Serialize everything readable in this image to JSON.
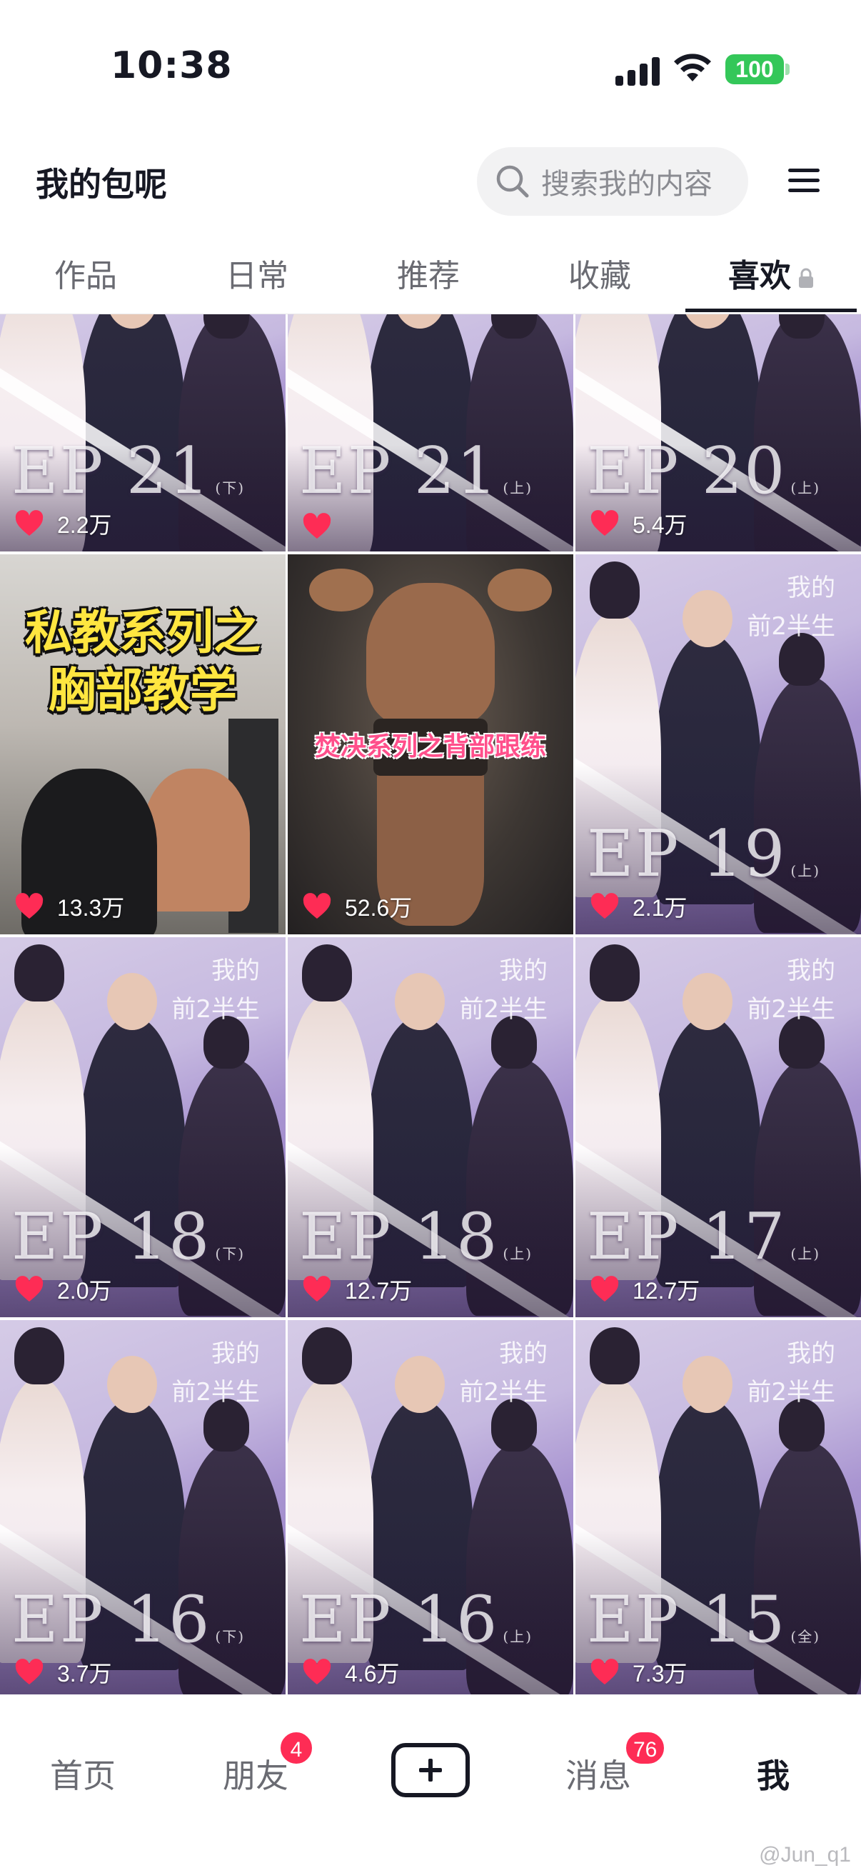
{
  "status_bar": {
    "time": "10:38",
    "battery": "100"
  },
  "header": {
    "profile_name": "我的包呢",
    "search_placeholder": "搜索我的内容"
  },
  "tabs": [
    {
      "label": "作品"
    },
    {
      "label": "日常"
    },
    {
      "label": "推荐"
    },
    {
      "label": "收藏"
    },
    {
      "label": "喜欢"
    }
  ],
  "grid": {
    "items": [
      {
        "type": "drama",
        "episode": "EP 21",
        "part": "(下)",
        "likes": "2.2万"
      },
      {
        "type": "drama",
        "episode": "EP 21",
        "part": "(上)",
        "likes": ""
      },
      {
        "type": "drama",
        "episode": "EP 20",
        "part": "(上)",
        "likes": "5.4万"
      },
      {
        "type": "gym",
        "title": "私教系列之\n胸部教学",
        "likes": "13.3万"
      },
      {
        "type": "gym",
        "title": "焚决系列之背部跟练",
        "likes": "52.6万"
      },
      {
        "type": "drama",
        "show_title": "我的\n前2半生",
        "episode": "EP 19",
        "part": "(上)",
        "likes": "2.1万"
      },
      {
        "type": "drama",
        "show_title": "我的\n前2半生",
        "episode": "EP 18",
        "part": "(下)",
        "likes": "2.0万"
      },
      {
        "type": "drama",
        "show_title": "我的\n前2半生",
        "episode": "EP 18",
        "part": "(上)",
        "likes": "12.7万"
      },
      {
        "type": "drama",
        "show_title": "我的\n前2半生",
        "episode": "EP 17",
        "part": "(上)",
        "likes": "12.7万"
      },
      {
        "type": "drama",
        "show_title": "我的\n前2半生",
        "episode": "EP 16",
        "part": "(下)",
        "likes": "3.7万"
      },
      {
        "type": "drama",
        "show_title": "我的\n前2半生",
        "episode": "EP 16",
        "part": "(上)",
        "likes": "4.6万"
      },
      {
        "type": "drama",
        "show_title": "我的\n前2半生",
        "episode": "EP 15",
        "part": "(全)",
        "likes": "7.3万"
      }
    ]
  },
  "bottom_nav": {
    "home": "首页",
    "friends": "朋友",
    "friends_badge": "4",
    "messages": "消息",
    "messages_badge": "76",
    "me": "我"
  },
  "watermark": "@Jun_q1",
  "colors": {
    "accent": "#fe2c55",
    "heart": "#fe2c55",
    "battery": "#34c759"
  }
}
